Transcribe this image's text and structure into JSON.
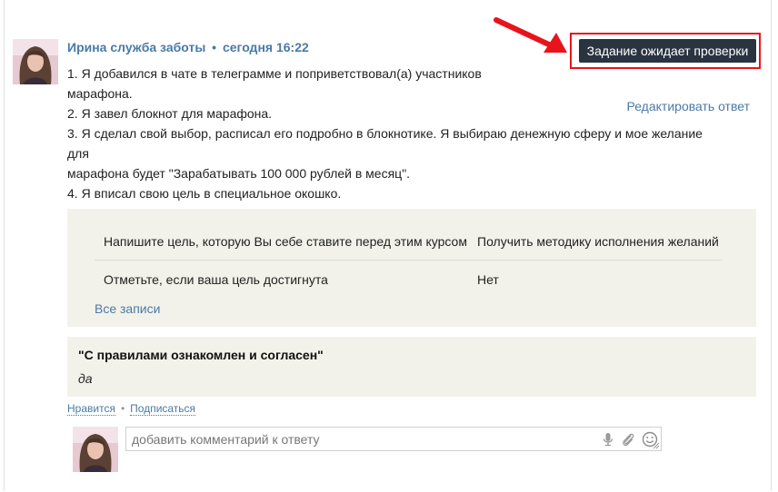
{
  "post": {
    "author": "Ирина служба заботы",
    "separator": "•",
    "time": "сегодня 16:22",
    "status_button": "Задание ожидает проверки",
    "answer_lines": [
      "1. Я добавился в чате в телеграмме и поприветствовал(а) участников",
      "марафона.",
      "2. Я завел блокнот для марафона.",
      "3. Я сделал свой выбор, расписал его подробно в блокнотике. Я выбираю денежную сферу и мое желание для",
      "марафона будет \"Зарабатывать 100 000 рублей в месяц\".",
      "4. Я вписал свою цель в специальное окошко."
    ],
    "edit_link": "Редактировать ответ"
  },
  "form_fields": {
    "rows": [
      {
        "question": "Напишите цель, которую Вы себе ставите перед этим курсом",
        "answer": "Получить методику исполнения желаний"
      },
      {
        "question": "Отметьте, если ваша цель достигнута",
        "answer": "Нет"
      }
    ],
    "all_records_link": "Все записи"
  },
  "rules": {
    "title": "\"С правилами ознакомлен и согласен\"",
    "answer": "да"
  },
  "actions": {
    "like": "Нравится",
    "separator": "•",
    "subscribe": "Подписаться"
  },
  "comment": {
    "placeholder": "добавить комментарий к ответу"
  },
  "colors": {
    "link": "#4a7aa6",
    "status_bg": "#2a3440",
    "highlight_red": "#e8141b",
    "panel_bg": "#f2f2ea"
  },
  "icons": [
    "microphone-icon",
    "paperclip-icon",
    "smiley-icon",
    "resize-handle-icon",
    "annotation-arrow-icon"
  ]
}
